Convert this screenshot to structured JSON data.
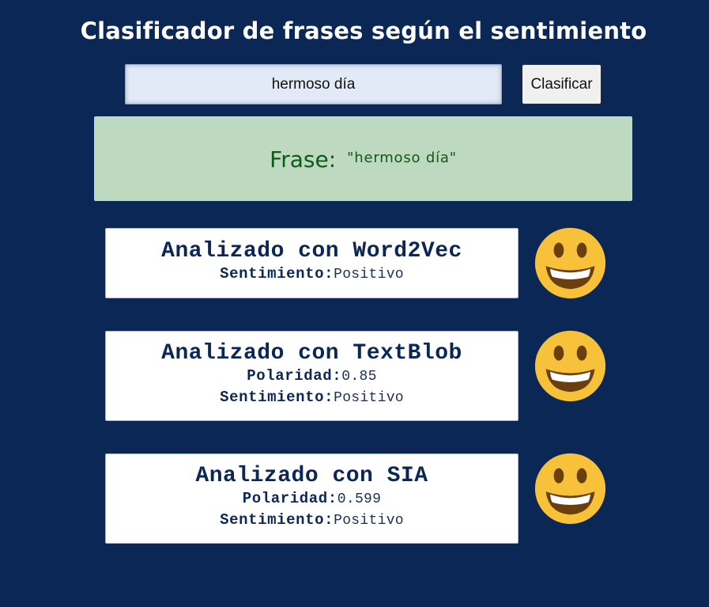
{
  "header": {
    "title": "Clasificador de frases según el sentimiento"
  },
  "form": {
    "input_value": "hermoso día",
    "classify_label": "Clasificar"
  },
  "phrase": {
    "label": "Frase:",
    "value": "\"hermoso día\""
  },
  "results": [
    {
      "title": "Analizado con Word2Vec",
      "sentiment_label": "Sentimiento:",
      "sentiment": "Positivo",
      "icon": "grinning-face-icon"
    },
    {
      "title": "Analizado con TextBlob",
      "polarity_label": "Polaridad:",
      "polarity": "0.85",
      "sentiment_label": "Sentimiento:",
      "sentiment": "Positivo",
      "icon": "grinning-face-icon"
    },
    {
      "title": "Analizado con SIA",
      "polarity_label": "Polaridad:",
      "polarity": "0.599",
      "sentiment_label": "Sentimiento:",
      "sentiment": "Positivo",
      "icon": "grinning-face-icon"
    }
  ],
  "colors": {
    "background": "#0b2756",
    "banner": "#bdd9bf",
    "banner_text": "#0f5a17",
    "card_text": "#0b2756",
    "emoji_face": "#f7c23a",
    "emoji_mouth": "#6b3f0d"
  }
}
